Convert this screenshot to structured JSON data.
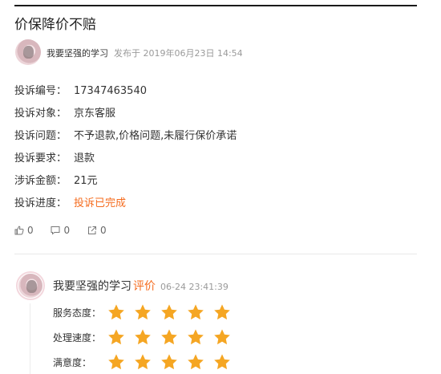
{
  "title": "价保降价不赔",
  "post": {
    "author": "我要坚强的学习",
    "published": "发布于 2019年06月23日 14:54"
  },
  "fields": [
    {
      "label": "投诉编号：",
      "value": "17347463540"
    },
    {
      "label": "投诉对象：",
      "value": "京东客服"
    },
    {
      "label": "投诉问题：",
      "value": "不予退款,价格问题,未履行保价承诺"
    },
    {
      "label": "投诉要求：",
      "value": "退款"
    },
    {
      "label": "涉诉金额：",
      "value": "21元"
    },
    {
      "label": "投诉进度：",
      "value": "投诉已完成"
    }
  ],
  "actions": {
    "likes": "0",
    "comments": "0",
    "shares": "0"
  },
  "review": {
    "author": "我要坚强的学习",
    "tag": "评价",
    "time": "06-24 23:41:39",
    "ratings": [
      {
        "label": "服务态度：",
        "stars": 5
      },
      {
        "label": "处理速度：",
        "stars": 5
      },
      {
        "label": "满意度：",
        "stars": 5
      }
    ]
  },
  "colors": {
    "accent": "#f56c1f",
    "star": "#f5a623"
  }
}
